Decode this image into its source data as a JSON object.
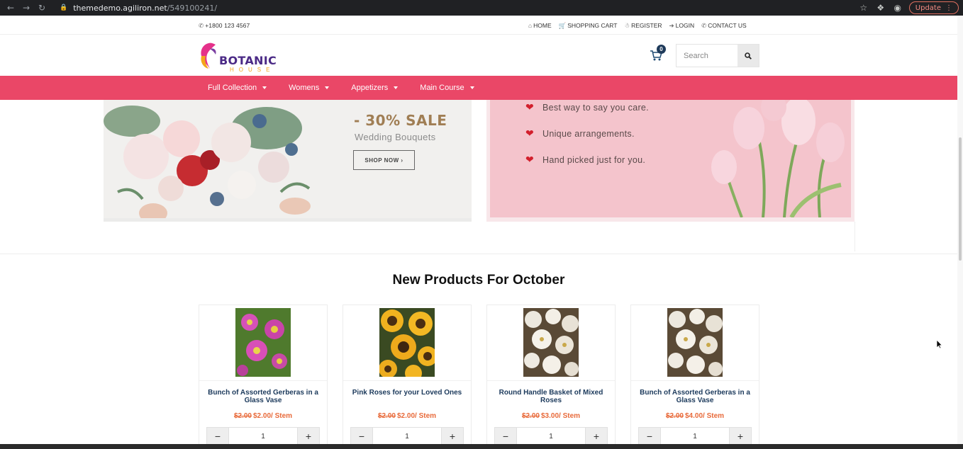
{
  "browser": {
    "url_host": "themedemo.agiliron.net",
    "url_path": "/549100241/",
    "update_label": "Update"
  },
  "topbar": {
    "phone": "+1800 123 4567",
    "links": [
      {
        "label": "HOME",
        "icon": "home-icon"
      },
      {
        "label": "SHOPPING CART",
        "icon": "cart-icon"
      },
      {
        "label": "REGISTER",
        "icon": "user-icon"
      },
      {
        "label": "LOGIN",
        "icon": "login-icon"
      },
      {
        "label": "CONTACT US",
        "icon": "phone-icon"
      }
    ]
  },
  "header": {
    "logo_word1": "BOTANIC",
    "logo_word2": "HOUSE",
    "cart_count": "0",
    "search_placeholder": "Search"
  },
  "nav": {
    "items": [
      {
        "label": "Full Collection"
      },
      {
        "label": "Womens"
      },
      {
        "label": "Appetizers"
      },
      {
        "label": "Main Course"
      }
    ]
  },
  "banners": {
    "left": {
      "sale": "- 30% SALE",
      "subtitle": "Wedding Bouquets",
      "cta": "SHOP NOW ›"
    },
    "right": {
      "lines": [
        "Best way to say you care.",
        "Unique arrangements.",
        "Hand picked just for you."
      ]
    }
  },
  "products": {
    "title": "New Products For October",
    "items": [
      {
        "name": "Bunch of Assorted Gerberas in a Glass Vase",
        "old_price": "$2.00",
        "price": "$2.00/ Stem",
        "qty": "1"
      },
      {
        "name": "Pink Roses for your Loved Ones",
        "old_price": "$2.00",
        "price": "$2.00/ Stem",
        "qty": "1"
      },
      {
        "name": "Round Handle Basket of Mixed Roses",
        "old_price": "$2.00",
        "price": "$3.00/ Stem",
        "qty": "1"
      },
      {
        "name": "Bunch of Assorted Gerberas in a Glass Vase",
        "old_price": "$2.00",
        "price": "$4.00/ Stem",
        "qty": "1"
      }
    ]
  },
  "colors": {
    "nav_bg": "#ea4767",
    "price": "#e86a3a",
    "product_name": "#1c3a5c"
  }
}
